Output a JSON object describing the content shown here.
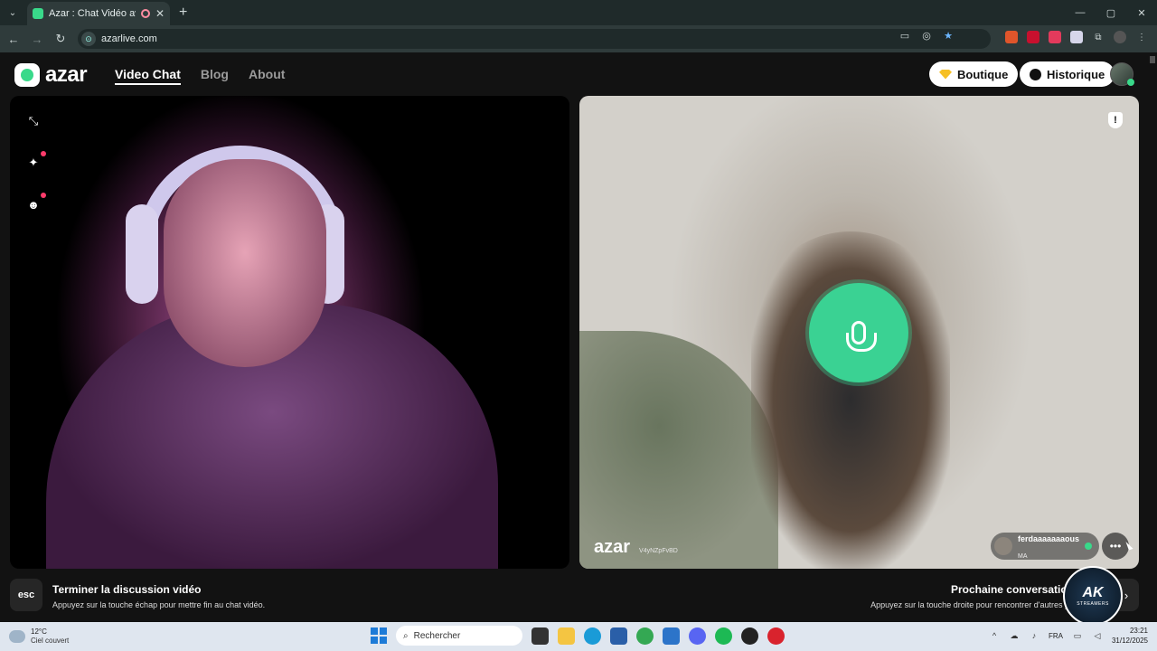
{
  "browser": {
    "tab_title": "Azar : Chat Vidéo avec de n",
    "url": "azarlive.com",
    "new_tab": "+",
    "window_controls": [
      "—",
      "▢",
      "✕"
    ]
  },
  "app": {
    "logo": "azar",
    "nav": [
      {
        "label": "Video Chat",
        "active": true
      },
      {
        "label": "Blog",
        "active": false
      },
      {
        "label": "About",
        "active": false
      }
    ],
    "shop_label": "Boutique",
    "history_label": "Historique"
  },
  "remote": {
    "watermark": "azar",
    "code": "V4yNZpFvBD",
    "username": "ferdaaaaaaaous",
    "country": "MA"
  },
  "hints": {
    "esc_key": "esc",
    "left_title": "Terminer la discussion vidéo",
    "left_sub": "Appuyez sur la touche échap pour mettre fin au chat vidéo.",
    "right_title": "Prochaine conversation",
    "right_sub": "Appuyez sur la touche droite pour rencontrer d'autres pe"
  },
  "overlay_badge": {
    "line1": "AK",
    "line2": "STREAMERS"
  },
  "taskbar": {
    "temp": "12°C",
    "condition": "Ciel couvert",
    "search_placeholder": "Rechercher",
    "lang": "FRA",
    "time": "23:21",
    "date": "31/12/2025"
  },
  "colors": {
    "accent_green": "#3ad293",
    "notif_red": "#ff3b6b",
    "gem_yellow": "#f6c026"
  }
}
